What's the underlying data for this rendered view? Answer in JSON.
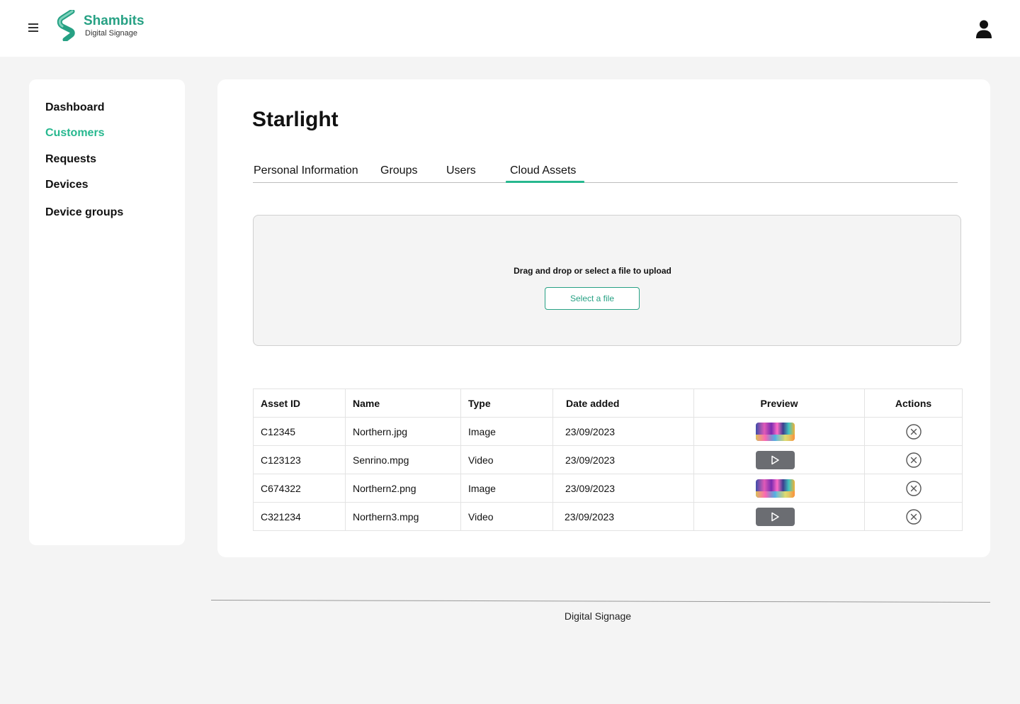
{
  "brand": {
    "name": "Shambits",
    "subtitle": "Digital Signage",
    "accent_color": "#27b88f",
    "logo_icon": "shambits-s-logo-icon"
  },
  "header": {
    "menu_icon": "hamburger-menu-icon",
    "user_icon": "user-account-icon"
  },
  "sidebar": {
    "items": [
      {
        "label": "Dashboard",
        "active": false
      },
      {
        "label": "Customers",
        "active": true
      },
      {
        "label": "Requests",
        "active": false
      },
      {
        "label": "Devices",
        "active": false
      },
      {
        "label": "Device groups",
        "active": false
      }
    ]
  },
  "main": {
    "title": "Starlight",
    "tabs": [
      {
        "label": "Personal Information",
        "active": false
      },
      {
        "label": "Groups",
        "active": false
      },
      {
        "label": "Users",
        "active": false
      },
      {
        "label": "Cloud Assets",
        "active": true
      }
    ],
    "upload": {
      "instruction": "Drag and drop or select a file to upload",
      "button_label": "Select a file"
    },
    "table": {
      "columns": [
        "Asset ID",
        "Name",
        "Type",
        "Date added",
        "Preview",
        "Actions"
      ],
      "rows": [
        {
          "id": "C12345",
          "name": "Northern.jpg",
          "type": "Image",
          "date": "23/09/2023",
          "preview": "image-thumbnail",
          "action": "remove-circle-icon"
        },
        {
          "id": "C123123",
          "name": "Senrino.mpg",
          "type": "Video",
          "date": "23/09/2023",
          "preview": "video-play-icon",
          "action": "remove-circle-icon"
        },
        {
          "id": "C674322",
          "name": "Northern2.png",
          "type": "Image",
          "date": "23/09/2023",
          "preview": "image-thumbnail",
          "action": "remove-circle-icon"
        },
        {
          "id": "C321234",
          "name": "Northern3.mpg",
          "type": "Video",
          "date": "23/09/2023",
          "preview": "video-play-icon",
          "action": "remove-circle-icon"
        }
      ]
    }
  },
  "footer": {
    "text": "Digital Signage"
  }
}
